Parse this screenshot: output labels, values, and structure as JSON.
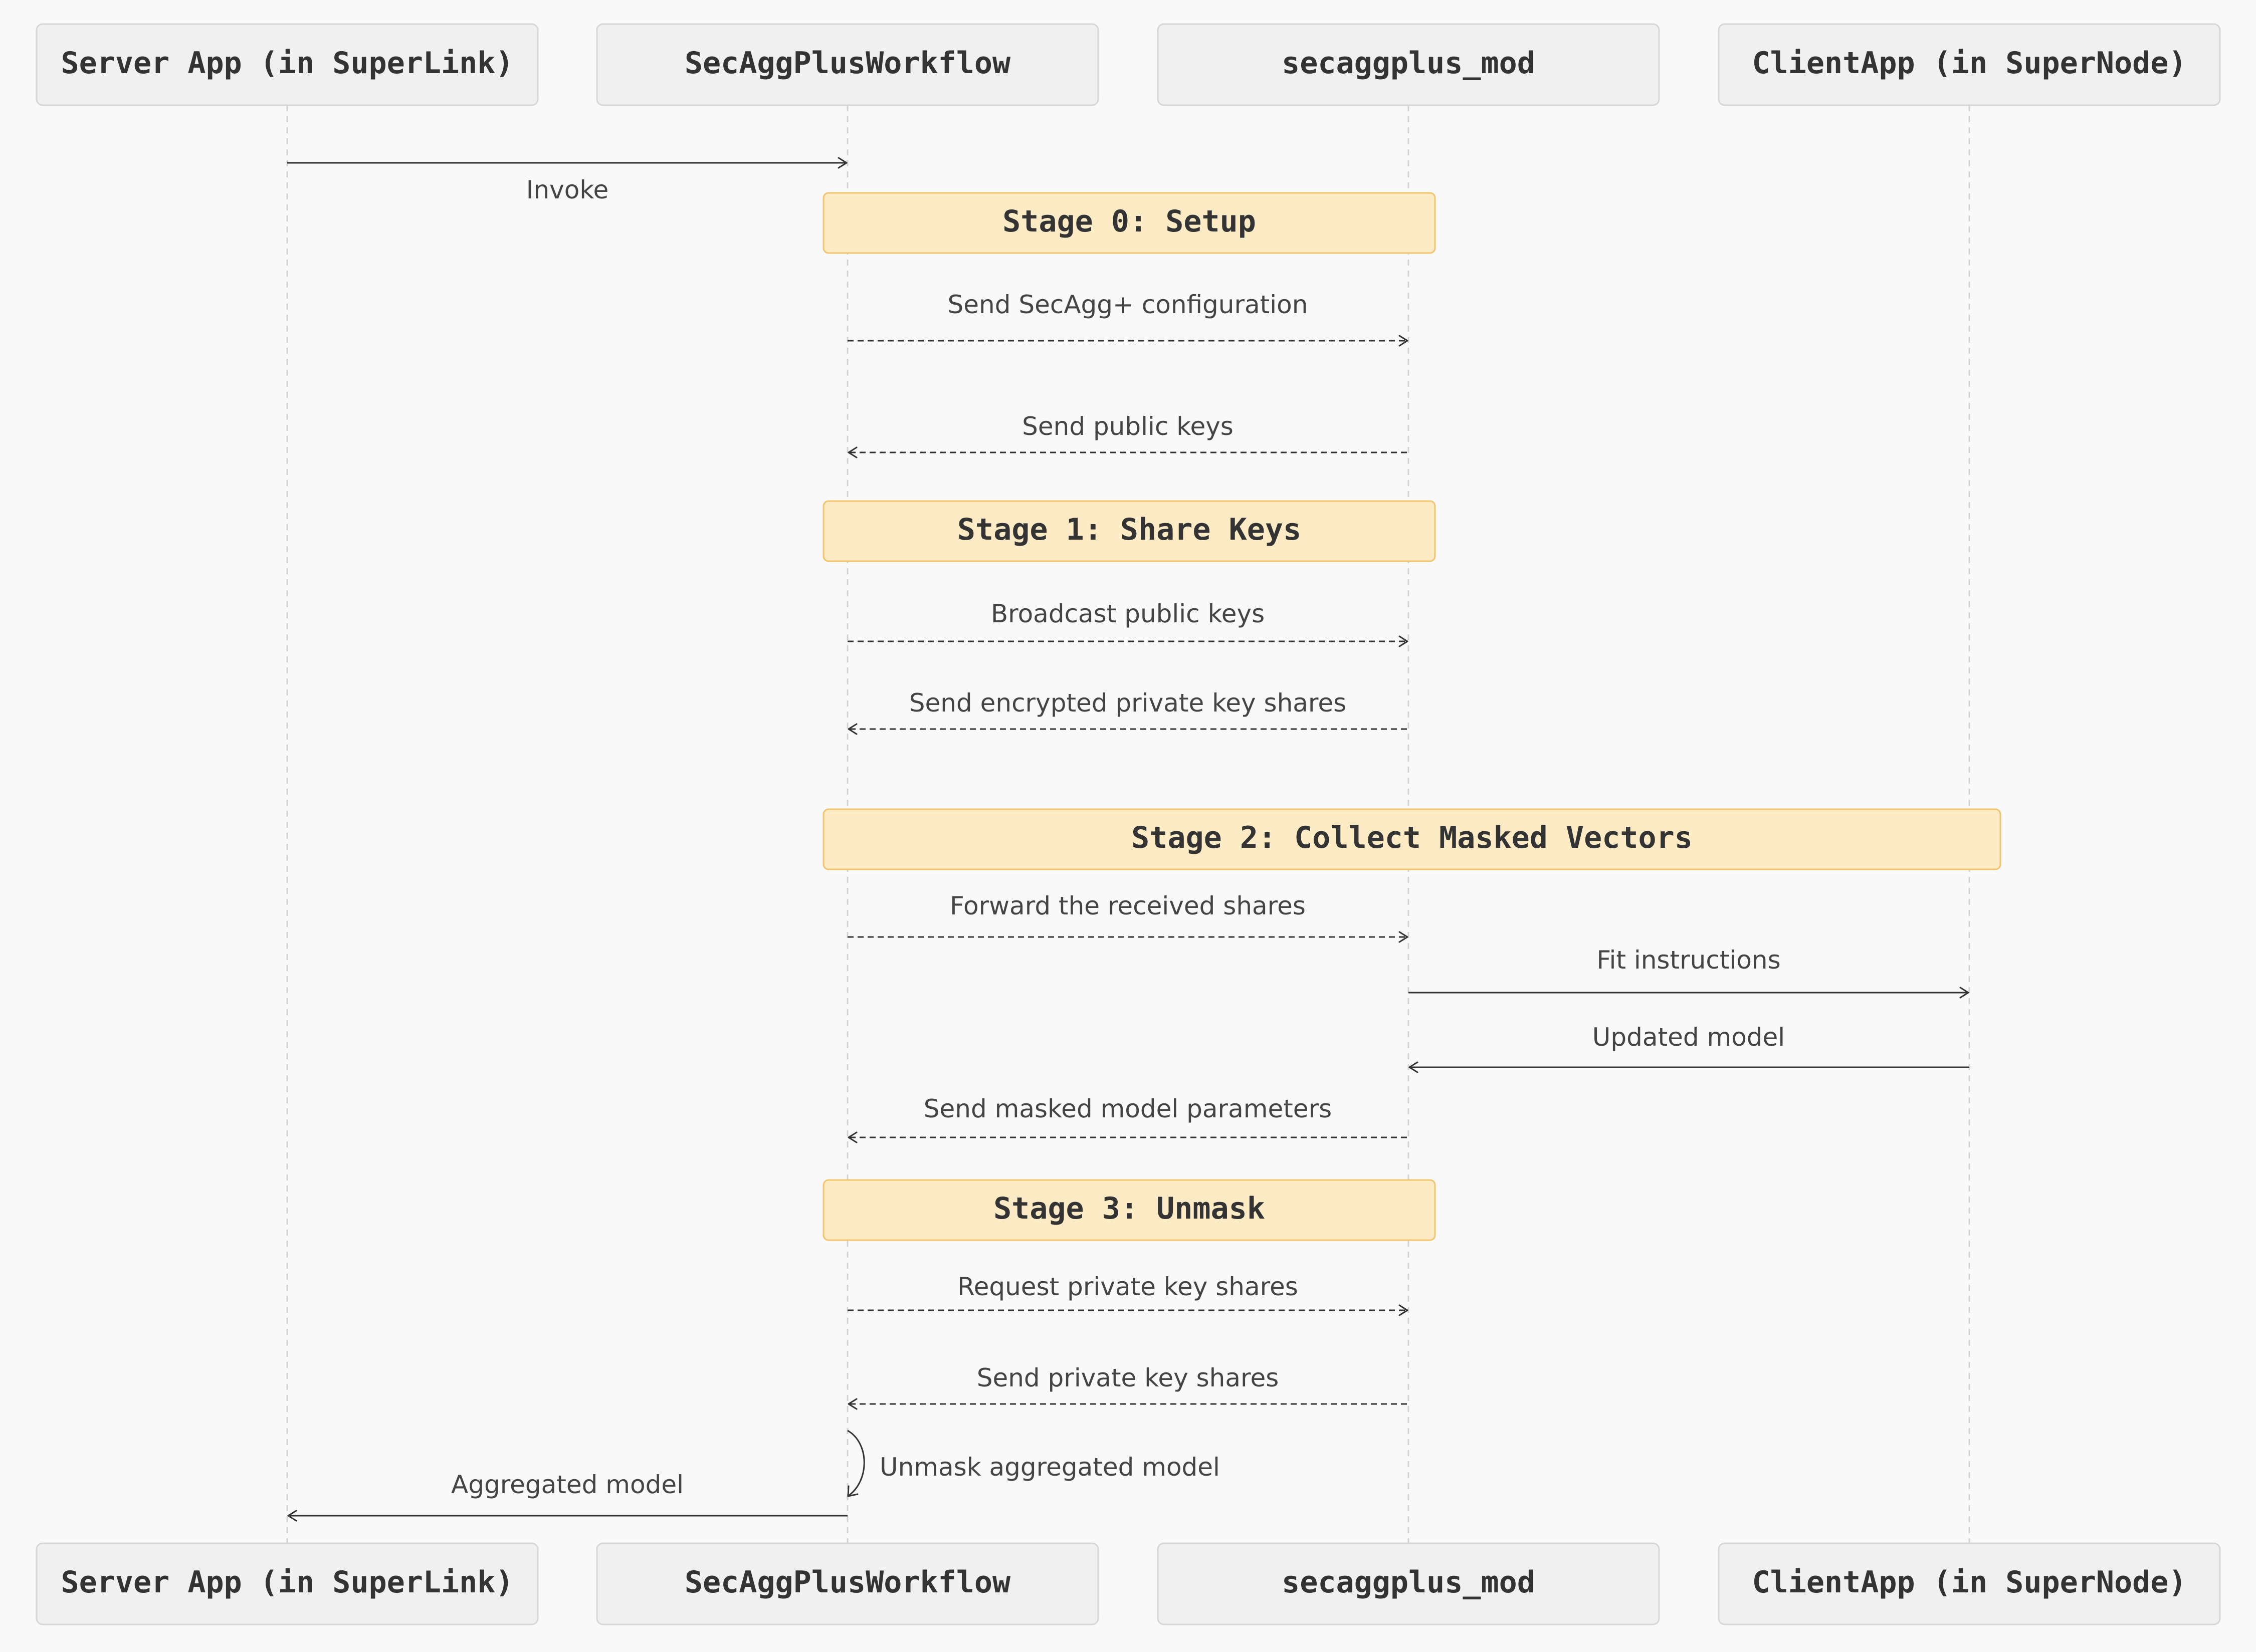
{
  "actors": [
    {
      "id": "server",
      "label": "Server App (in SuperLink)"
    },
    {
      "id": "workflow",
      "label": "SecAggPlusWorkflow"
    },
    {
      "id": "mod",
      "label": "secaggplus_mod"
    },
    {
      "id": "client",
      "label": "ClientApp (in SuperNode)"
    }
  ],
  "stages": [
    {
      "label": "Stage 0: Setup",
      "from": "workflow",
      "to": "mod"
    },
    {
      "label": "Stage 1: Share Keys",
      "from": "workflow",
      "to": "mod"
    },
    {
      "label": "Stage 2: Collect Masked Vectors",
      "from": "workflow",
      "to": "client"
    },
    {
      "label": "Stage 3: Unmask",
      "from": "workflow",
      "to": "mod"
    }
  ],
  "messages": [
    {
      "label": "Invoke",
      "from": "server",
      "to": "workflow",
      "style": "solid"
    },
    {
      "label": "Send SecAgg+ configuration",
      "from": "workflow",
      "to": "mod",
      "style": "dashed"
    },
    {
      "label": "Send public keys",
      "from": "mod",
      "to": "workflow",
      "style": "dashed"
    },
    {
      "label": "Broadcast public keys",
      "from": "workflow",
      "to": "mod",
      "style": "dashed"
    },
    {
      "label": "Send encrypted private key shares",
      "from": "mod",
      "to": "workflow",
      "style": "dashed"
    },
    {
      "label": "Forward the received shares",
      "from": "workflow",
      "to": "mod",
      "style": "dashed"
    },
    {
      "label": "Fit instructions",
      "from": "mod",
      "to": "client",
      "style": "solid"
    },
    {
      "label": "Updated model",
      "from": "client",
      "to": "mod",
      "style": "solid"
    },
    {
      "label": "Send masked model parameters",
      "from": "mod",
      "to": "workflow",
      "style": "dashed"
    },
    {
      "label": "Request private key shares",
      "from": "workflow",
      "to": "mod",
      "style": "dashed"
    },
    {
      "label": "Send private key shares",
      "from": "mod",
      "to": "workflow",
      "style": "dashed"
    },
    {
      "label": "Unmask aggregated model",
      "from": "workflow",
      "to": "workflow",
      "style": "solid"
    },
    {
      "label": "Aggregated model",
      "from": "workflow",
      "to": "server",
      "style": "solid"
    }
  ],
  "colors": {
    "background": "#f9f9f9",
    "actor_fill": "#f0f0f0",
    "stage_fill": "#fdebc6",
    "stage_border": "#f2c56c"
  }
}
